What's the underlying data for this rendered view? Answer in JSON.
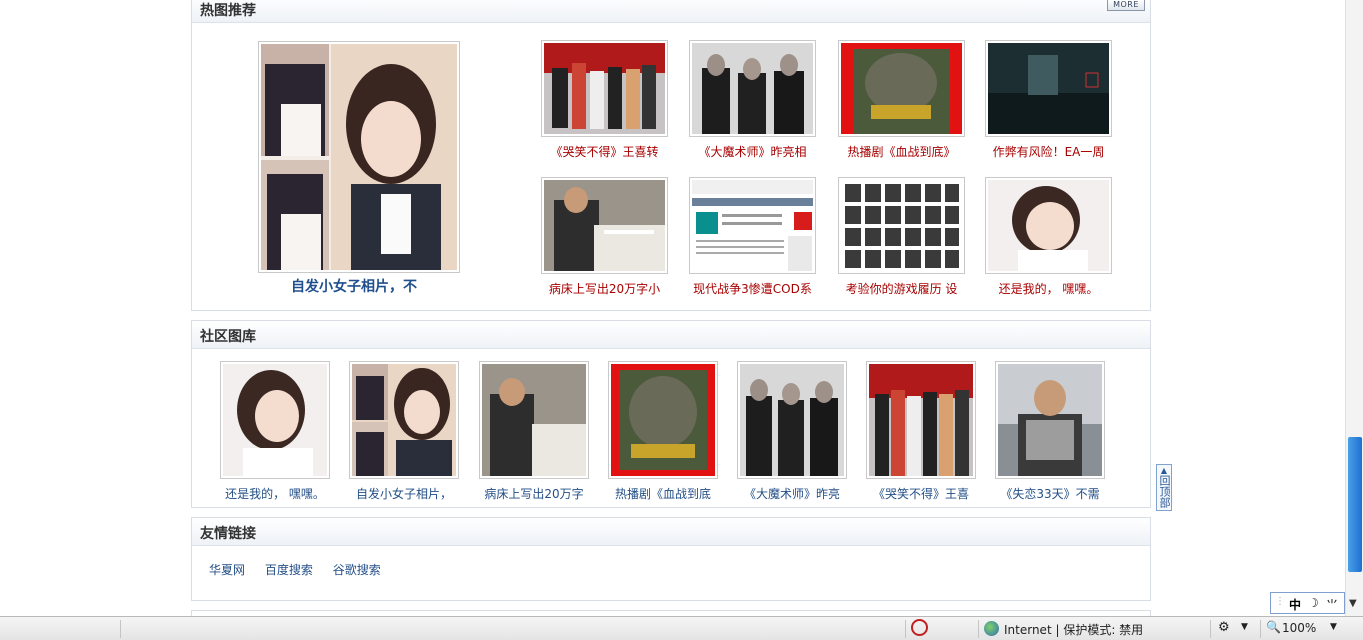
{
  "hot": {
    "title": "热图推荐",
    "more": "MORE",
    "featured_caption": "自发小女子相片，不",
    "items": [
      {
        "caption": "《哭笑不得》王喜转"
      },
      {
        "caption": "《大魔术师》昨亮相"
      },
      {
        "caption": "热播剧《血战到底》"
      },
      {
        "caption": "作弊有风险！EA一周"
      },
      {
        "caption": "病床上写出20万字小"
      },
      {
        "caption": "现代战争3惨遭COD系"
      },
      {
        "caption": "考验你的游戏履历 设"
      },
      {
        "caption": "还是我的， 嘿嘿。"
      }
    ]
  },
  "community": {
    "title": "社区图库",
    "items": [
      {
        "caption": "还是我的， 嘿嘿。"
      },
      {
        "caption": "自发小女子相片，"
      },
      {
        "caption": "病床上写出20万字"
      },
      {
        "caption": "热播剧《血战到底"
      },
      {
        "caption": "《大魔术师》昨亮"
      },
      {
        "caption": "《哭笑不得》王喜"
      },
      {
        "caption": "《失恋33天》不需"
      }
    ]
  },
  "friends": {
    "title": "友情链接",
    "links": [
      "华夏网",
      "百度搜索",
      "谷歌搜索"
    ]
  },
  "totop": "回顶部",
  "statusbar": {
    "zone": "Internet | 保护模式: 禁用",
    "zoom": "100%"
  },
  "ime": {
    "lang": "中"
  }
}
